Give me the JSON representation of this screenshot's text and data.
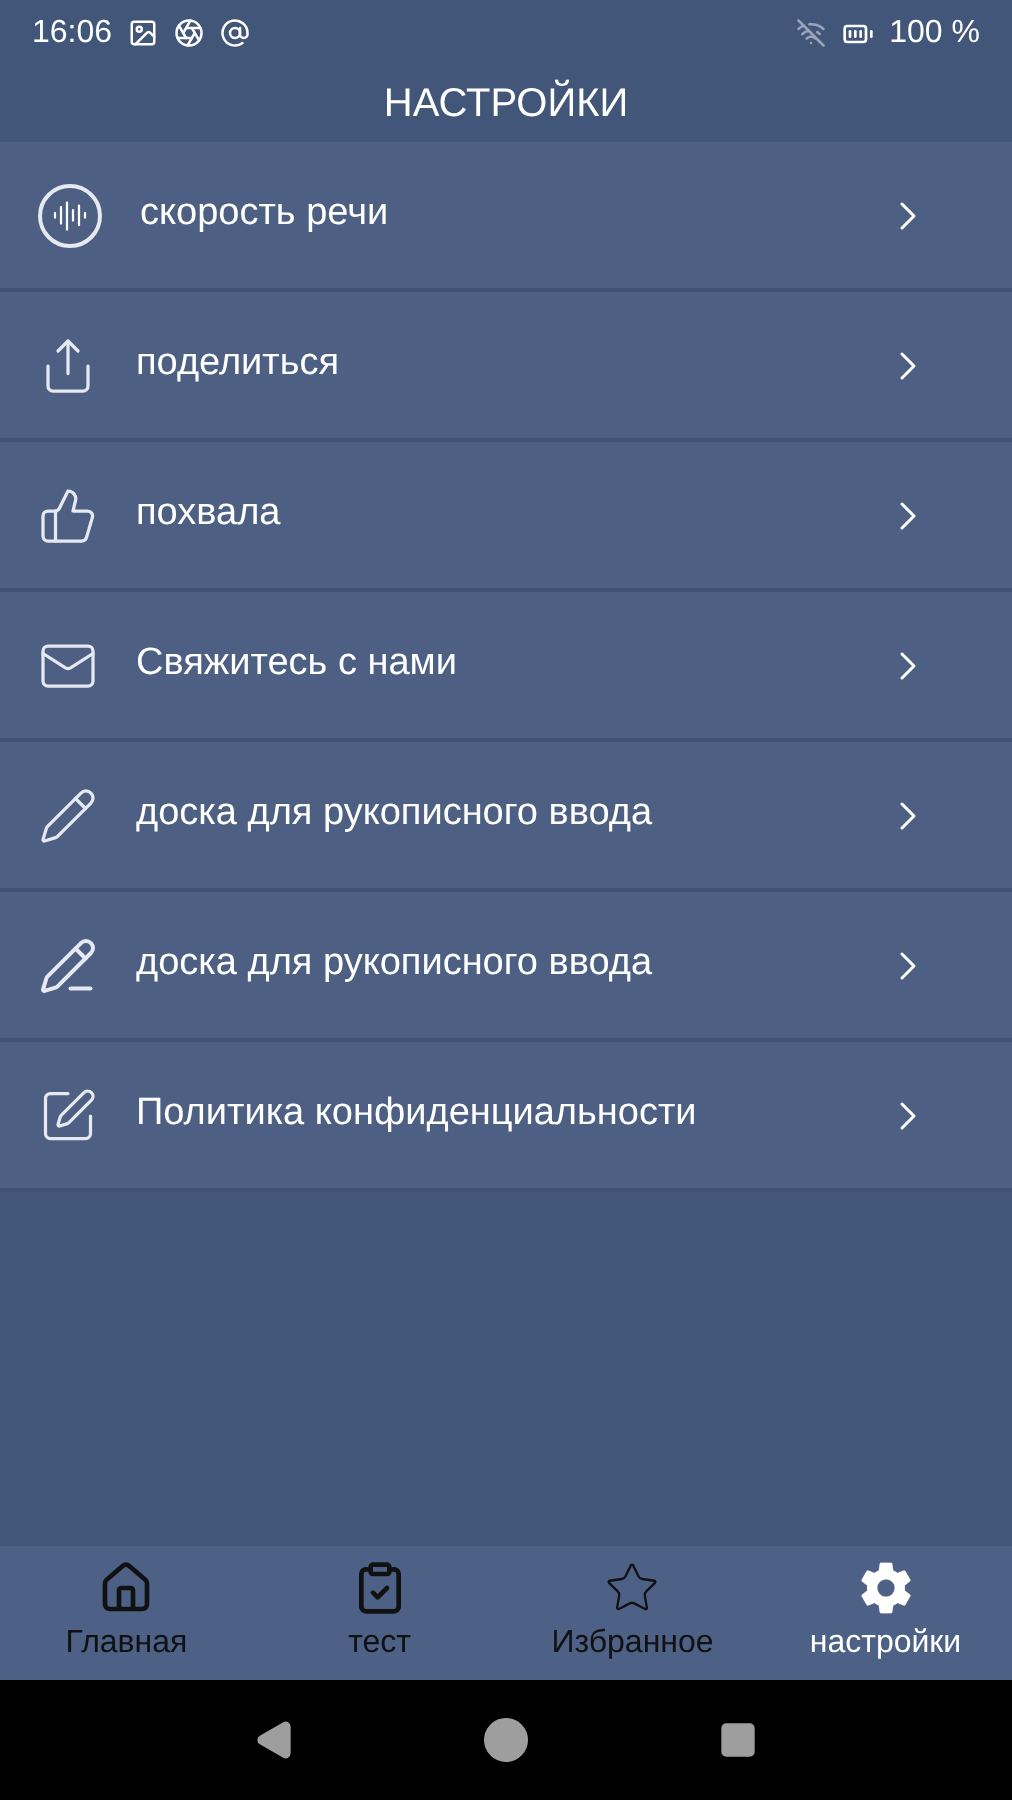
{
  "status_bar": {
    "time": "16:06",
    "battery": "100 %"
  },
  "header": {
    "title": "НАСТРОЙКИ"
  },
  "settings": [
    {
      "label": "скорость речи"
    },
    {
      "label": "поделиться"
    },
    {
      "label": "похвала"
    },
    {
      "label": "Свяжитесь с нами"
    },
    {
      "label": "доска для рукописного ввода"
    },
    {
      "label": "доска для рукописного ввода"
    },
    {
      "label": "Политика конфиденциальности"
    }
  ],
  "bottom_nav": [
    {
      "label": "Главная",
      "selected": false
    },
    {
      "label": "тест",
      "selected": false
    },
    {
      "label": "Избранное",
      "selected": false
    },
    {
      "label": "настройки",
      "selected": true
    }
  ]
}
